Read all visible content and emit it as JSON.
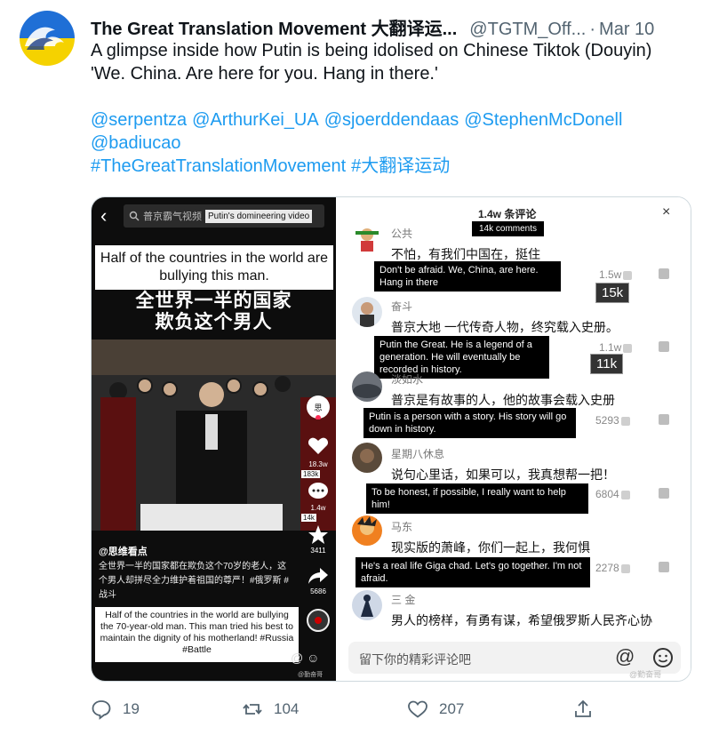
{
  "tweet": {
    "author": "The Great Translation Movement 大翻译运...",
    "handle": "@TGTM_Off...",
    "dot": "·",
    "date": "Mar 10",
    "line1": "A glimpse inside how Putin is being idolised on Chinese Tiktok (Douyin)",
    "line2": "'We. China. Are here for you. Hang in there.'",
    "mentions_row1": [
      "@serpentza",
      "@ArthurKei_UA",
      "@sjoerddendaas",
      "@StephenMcDonell"
    ],
    "mentions_row2": [
      "@badiucao"
    ],
    "hashtags": [
      "#TheGreatTranslationMovement",
      "#大翻译运动"
    ]
  },
  "video": {
    "search_zh": "普京霸气视频",
    "search_en": "Putin's domineering video",
    "caption_en": "Half of the countries in the world are bullying this man.",
    "caption_zh_1": "全世界一半的国家",
    "caption_zh_2": "欺负这个男人",
    "likes": "18.3w",
    "likes_en": "183k",
    "comments": "1.4w",
    "comments_en": "14k",
    "favorites": "3411",
    "shares": "5686",
    "uploader": "@思维看点",
    "desc_zh": "全世界一半的国家都在欺负这个70岁的老人，这个男人却拼尽全力维护着祖国的尊严！#俄罗斯 #战斗",
    "desc_en": "Half of the countries in the world are bullying the 70-year-old man. This man tried his best to maintain the dignity of his motherland! #Russia #Battle",
    "watermark": "@勤奋哥"
  },
  "comments_panel": {
    "title": "1.4w 条评论",
    "title_en": "14k comments",
    "close": "×",
    "items": [
      {
        "name": "公共",
        "text": "不怕，有我们中国在，挺住",
        "trans": "Don't be afraid. We, China, are here. Hang in there",
        "likes": "1.5w",
        "likes_en": "15k"
      },
      {
        "name": "奋斗",
        "text": "普京大地 一代传奇人物，终究载入史册。",
        "trans": "Putin the Great. He is a legend of a generation. He will eventually be recorded in history.",
        "likes": "1.1w",
        "likes_en": "11k"
      },
      {
        "name": "淡如水",
        "text": "普京是有故事的人，他的故事会载入史册",
        "trans": "Putin is a person with a story. His story will go down in history.",
        "likes": "5293"
      },
      {
        "name": "星期八休息",
        "text": "说句心里话，如果可以，我真想帮一把！",
        "trans": "To be honest, if possible, I really want to help him!",
        "likes": "6804"
      },
      {
        "name": "马东",
        "text": "现实版的萧峰，你们一起上，我何惧",
        "trans": "He's a real life Giga chad. Let's go together. I'm not afraid.",
        "likes": "2278"
      },
      {
        "name": "三 金",
        "text": "男人的榜样，有勇有谋，希望俄罗斯人民齐心协",
        "trans": "",
        "likes": ""
      }
    ],
    "input_placeholder": "留下你的精彩评论吧",
    "at_symbol": "@",
    "watermark": "@勤奋哥"
  },
  "actions": {
    "replies": "19",
    "retweets": "104",
    "likes": "207"
  }
}
